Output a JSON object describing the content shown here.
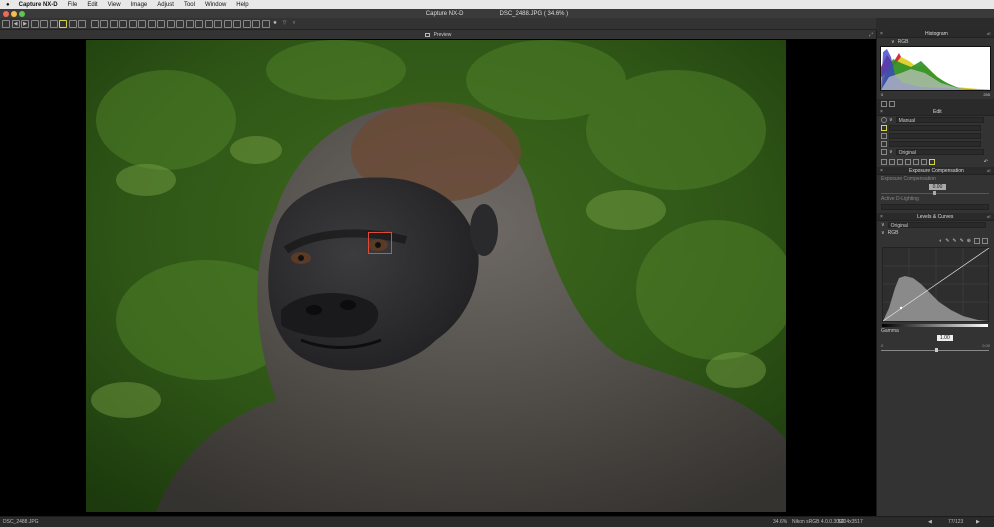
{
  "menubar": {
    "apple": "",
    "items": [
      "Capture NX-D",
      "File",
      "Edit",
      "View",
      "Image",
      "Adjust",
      "Tool",
      "Window",
      "Help"
    ]
  },
  "window": {
    "app_title": "Capture NX-D",
    "file_title": "DSC_2488.JPG ( 34.6% )"
  },
  "viewer": {
    "header": "Preview"
  },
  "status": {
    "filename": "DSC_2488.JPG",
    "zoom": "34.6%",
    "colorspace": "Nikon sRGB 4.0.0.3002",
    "dimensions": "5204x3517",
    "page": "77/123"
  },
  "histogram": {
    "title": "Histogram",
    "channel": "RGB",
    "min": "0",
    "max": "255"
  },
  "edit": {
    "title": "Edit",
    "preset": "Manual",
    "version": "Original"
  },
  "exposure": {
    "title": "Exposure Compensation",
    "label": "Exposure Compensation",
    "value": "0.00",
    "dlighting": "Active D-Lighting"
  },
  "levels": {
    "title": "Levels & Curves",
    "preset": "Original",
    "channel": "RGB",
    "gamma_label": "Gamma",
    "gamma": "1.00",
    "out_min": "0",
    "out_max": "0.00"
  },
  "colors": {
    "accent": "#e04a3a",
    "panel": "#333333",
    "header": "#2a2a2a"
  }
}
